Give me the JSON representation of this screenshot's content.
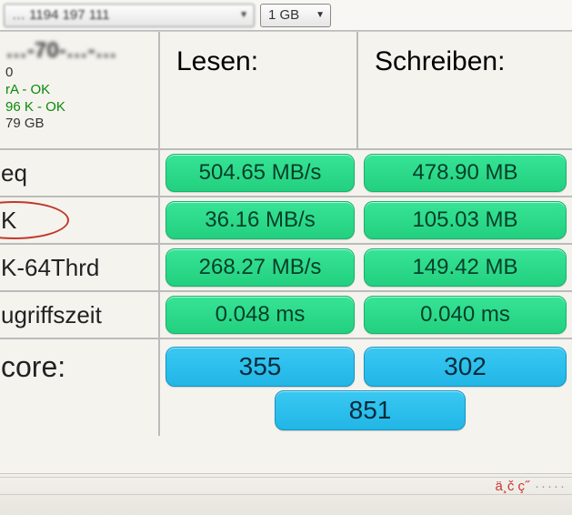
{
  "toolbar": {
    "drive_label": "… 1194 197 111",
    "size_label": "1 GB"
  },
  "info": {
    "name_line": "…-70-…-…",
    "line0": "0",
    "lineA": "rA - OK",
    "lineK": "96 K - OK",
    "lineGB": "79 GB"
  },
  "headers": {
    "read": "Lesen:",
    "write": "Schreiben:"
  },
  "rows": {
    "seq": {
      "label": "eq",
      "read": "504.65 MB/s",
      "write": "478.90 MB"
    },
    "k": {
      "label": "K",
      "read": "36.16 MB/s",
      "write": "105.03 MB"
    },
    "k64": {
      "label": "K-64Thrd",
      "read": "268.27 MB/s",
      "write": "149.42 MB"
    },
    "acc": {
      "label": "ugriffszeit",
      "read": "0.048 ms",
      "write": "0.040 ms"
    }
  },
  "score": {
    "label": "core:",
    "read": "355",
    "write": "302",
    "total": "851"
  },
  "status": {
    "text": "ä¸č ç˝",
    "sep": "·····"
  },
  "colors": {
    "speed_pill": "#22d07f",
    "score_pill": "#22b6e6",
    "ok_text": "#0a8a0a",
    "ellipse": "#c0392b"
  }
}
